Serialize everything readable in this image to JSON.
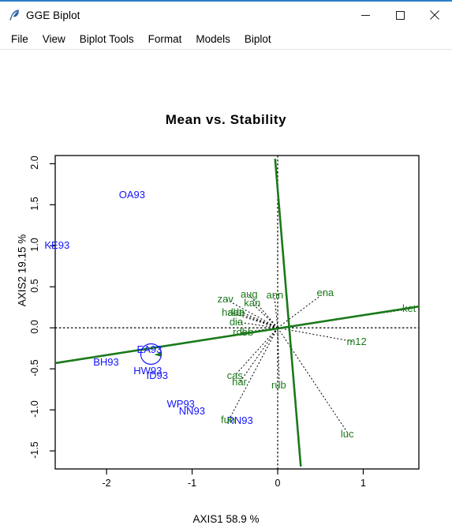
{
  "window": {
    "title": "GGE Biplot",
    "icon": "feather-quill-icon",
    "controls": {
      "minimize": "—",
      "maximize": "☐",
      "close": "✕"
    }
  },
  "menu": {
    "items": [
      {
        "label": "File"
      },
      {
        "label": "View"
      },
      {
        "label": "Biplot Tools"
      },
      {
        "label": "Format"
      },
      {
        "label": "Models"
      },
      {
        "label": "Biplot"
      }
    ]
  },
  "chart_data": {
    "type": "scatter",
    "title": "Mean vs. Stability",
    "xlabel": "AXIS1 58.9 %",
    "ylabel": "AXIS2 19.15 %",
    "xlim": [
      -2.6,
      1.65
    ],
    "ylim": [
      -1.72,
      2.1
    ],
    "xticks": [
      -2,
      -1,
      0,
      1
    ],
    "xticklabels": [
      "-2",
      "-1",
      "0",
      "1"
    ],
    "yticks": [
      -1.5,
      -1.0,
      -0.5,
      0.0,
      0.5,
      1.0,
      1.5,
      2.0
    ],
    "yticklabels": [
      "-1.5",
      "-1.0",
      "-0.5",
      "0.0",
      "0.5",
      "1.0",
      "1.5",
      "2.0"
    ],
    "grid": false,
    "legend": "none",
    "colors": {
      "genotype": "#1414ff",
      "environment": "#1a7a1a",
      "axis_line": "#000000",
      "reference_dotted": "#000000"
    },
    "series": [
      {
        "name": "Genotypes",
        "color": "#1414ff",
        "points": [
          {
            "label": "OA93",
            "x": -1.73,
            "y": 1.62
          },
          {
            "label": "KE93",
            "x": -2.6,
            "y": 1.0
          },
          {
            "label": "EA93",
            "x": -1.52,
            "y": -0.27
          },
          {
            "label": "BH93",
            "x": -2.03,
            "y": -0.42
          },
          {
            "label": "HW93",
            "x": -1.56,
            "y": -0.53
          },
          {
            "label": "ID93",
            "x": -1.41,
            "y": -0.58
          },
          {
            "label": "WP93",
            "x": -1.17,
            "y": -0.93
          },
          {
            "label": "NN93",
            "x": -1.03,
            "y": -1.02
          },
          {
            "label": "RN93",
            "x": -0.47,
            "y": -1.13
          }
        ]
      },
      {
        "name": "Environments",
        "color": "#1a7a1a",
        "points": [
          {
            "label": "zav",
            "x": -0.61,
            "y": 0.35
          },
          {
            "label": "aug",
            "x": -0.34,
            "y": 0.41
          },
          {
            "label": "kan",
            "x": -0.3,
            "y": 0.3
          },
          {
            "label": "ann",
            "x": -0.04,
            "y": 0.4
          },
          {
            "label": "ena",
            "x": 0.55,
            "y": 0.43
          },
          {
            "label": "hal",
            "x": -0.56,
            "y": 0.19
          },
          {
            "label": "ade",
            "x": -0.49,
            "y": 0.19
          },
          {
            "label": "lati",
            "x": -0.42,
            "y": 0.19
          },
          {
            "label": "dia",
            "x": -0.47,
            "y": 0.07
          },
          {
            "label": "rol",
            "x": -0.43,
            "y": -0.06
          },
          {
            "label": "leb",
            "x": -0.35,
            "y": -0.06
          },
          {
            "label": "ket",
            "x": 1.55,
            "y": 0.23
          },
          {
            "label": "m12",
            "x": 0.9,
            "y": -0.17
          },
          {
            "label": "cas",
            "x": -0.5,
            "y": -0.58
          },
          {
            "label": "har",
            "x": -0.44,
            "y": -0.66
          },
          {
            "label": "rub",
            "x": 0.02,
            "y": -0.7
          },
          {
            "label": "fun",
            "x": -0.57,
            "y": -1.12
          },
          {
            "label": "luc",
            "x": 0.83,
            "y": -1.3
          }
        ]
      }
    ],
    "annotations": {
      "average_environment_axis": {
        "label": "AEA-line",
        "color": "#1a7a1a",
        "x1": -2.6,
        "y1": -0.43,
        "x2": 1.65,
        "y2": 0.26
      },
      "perpendicular_axis": {
        "label": "AEA-perpendicular",
        "color": "#1a7a1a",
        "x1": -0.03,
        "y1": 2.06,
        "x2": 0.27,
        "y2": -1.69
      },
      "origin_marker": {
        "label": "average-environment-circle",
        "color": "#1414ff",
        "x": -1.48,
        "y": -0.32,
        "r": 0.12
      }
    }
  }
}
